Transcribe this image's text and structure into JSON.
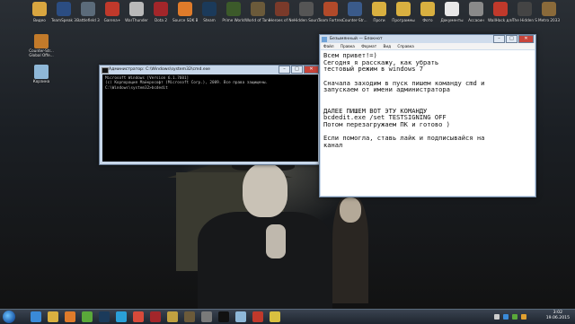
{
  "desktop": {
    "top_icons": [
      {
        "label": "Видео",
        "color": "#d9a640"
      },
      {
        "label": "TeamSpeak 3 Client",
        "color": "#2b4d82"
      },
      {
        "label": "Battlefield 3",
        "color": "#5b6b7a"
      },
      {
        "label": "Garena+",
        "color": "#c0392b"
      },
      {
        "label": "WarThunder",
        "color": "#b9b9b9"
      },
      {
        "label": "Dota 2",
        "color": "#a3262a"
      },
      {
        "label": "Source SDK Base 2006",
        "color": "#e07b2a"
      },
      {
        "label": "Steam",
        "color": "#1b3a5a"
      },
      {
        "label": "Prime World",
        "color": "#3c5a2a"
      },
      {
        "label": "World of Tanks",
        "color": "#6b5a3a"
      },
      {
        "label": "Heroes of Newerth",
        "color": "#7a3a2a"
      },
      {
        "label": "Hidden Source",
        "color": "#555555"
      },
      {
        "label": "Team Fortress 2",
        "color": "#b24a2a"
      },
      {
        "label": "Counter-Str... 1.6",
        "color": "#3a5a8a"
      },
      {
        "label": "Проги",
        "color": "#d9b040"
      },
      {
        "label": "Программы",
        "color": "#d9b040"
      },
      {
        "label": "Фото",
        "color": "#d9b040"
      },
      {
        "label": "Документы",
        "color": "#e8e8e8"
      },
      {
        "label": "Ассасин",
        "color": "#8a8a8a"
      },
      {
        "label": "WallHack для CSS v34",
        "color": "#c0392b"
      },
      {
        "label": "The Hidden Source",
        "color": "#444444"
      },
      {
        "label": "Metro 2033",
        "color": "#8a6a3a"
      }
    ],
    "left_icons": [
      {
        "label": "Counter-Str... Global Offe...",
        "color": "#c27a2a"
      },
      {
        "label": "Корзина",
        "color": "#8fb8d8"
      }
    ]
  },
  "cmd_window": {
    "title": "Администратор: C:\\Windows\\system32\\cmd.exe",
    "buttons": {
      "min": "–",
      "max": "□",
      "close": "✕"
    },
    "lines": [
      "Microsoft Windows [Version 6.1.7601]",
      "(c) Корпорация Майкрософт (Microsoft Corp.), 2009. Все права защищены.",
      "",
      "C:\\Windows\\system32>bcdedit"
    ]
  },
  "notepad": {
    "title": "Безымянный — Блокнот",
    "menu": [
      "Файл",
      "Правка",
      "Формат",
      "Вид",
      "Справка"
    ],
    "buttons": {
      "min": "–",
      "max": "□",
      "close": "✕"
    },
    "lines": [
      "Всем привет!=)",
      "Сегодня я расскажу, как убрать",
      "тестовый режим в windows 7",
      "",
      "Сначала заходим в пуск пишем команду cmd и",
      "запускаем от имени администратора",
      "",
      "",
      "ДАЛЕЕ ПИШЕМ ВОТ ЭТУ КОМАНДУ",
      "bcdedit.exe /set TESTSIGNING OFF",
      "Потом перезагружаем ПК и готово )",
      "",
      "Если помогла, ставь лайк и подписывайся на",
      "канал"
    ]
  },
  "taskbar": {
    "pinned": [
      {
        "name": "ie-icon",
        "color": "#3a8ad8"
      },
      {
        "name": "explorer-icon",
        "color": "#d9b040"
      },
      {
        "name": "media-player-icon",
        "color": "#e07b2a"
      },
      {
        "name": "utorrent-icon",
        "color": "#5aa83a"
      },
      {
        "name": "steam-icon",
        "color": "#1b3a5a"
      },
      {
        "name": "skype-icon",
        "color": "#2aa0d8"
      },
      {
        "name": "chrome-icon",
        "color": "#d84a3a"
      },
      {
        "name": "dota-icon",
        "color": "#a3262a"
      },
      {
        "name": "game-icon",
        "color": "#c0a040"
      },
      {
        "name": "wot-icon",
        "color": "#6b5a3a"
      },
      {
        "name": "app-icon",
        "color": "#7a7a7a"
      },
      {
        "name": "cmd-icon",
        "color": "#111111"
      },
      {
        "name": "notepad-icon",
        "color": "#8fb8d8"
      },
      {
        "name": "bandicam-icon",
        "color": "#c0392b"
      },
      {
        "name": "fraps-icon",
        "color": "#d8c040"
      }
    ],
    "tray_colors": [
      "#cccccc",
      "#3a8ad8",
      "#5aa83a",
      "#e0a030"
    ],
    "clock": {
      "time": "3:02",
      "date": "19.06.2015"
    }
  }
}
